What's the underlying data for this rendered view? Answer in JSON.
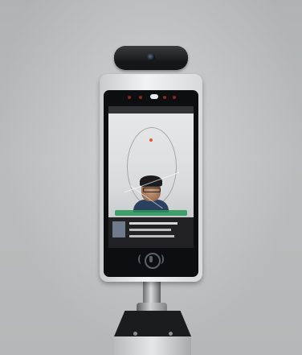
{
  "scene": {
    "description_colors": {
      "wall": "#c2c4c5",
      "device_frame": "#e9eaeb",
      "bezel": "#0d0e10",
      "accent_temperature": "#d33a2c",
      "banner": "#2a9b5e"
    },
    "screen": {
      "status_left": "",
      "status_center": "",
      "status_right": "",
      "temperature": "",
      "banner_text": "",
      "info_lines": []
    },
    "icons": [
      "camera-lens-icon",
      "nfc-icon"
    ]
  }
}
